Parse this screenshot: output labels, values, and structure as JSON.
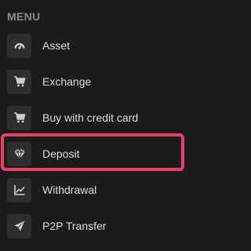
{
  "menu": {
    "heading": "MENU",
    "items": [
      {
        "label": "Asset",
        "icon": "gauge-icon"
      },
      {
        "label": "Exchange",
        "icon": "cart-icon"
      },
      {
        "label": "Buy with credit card",
        "icon": "cart-icon"
      },
      {
        "label": "Deposit",
        "icon": "diamond-icon"
      },
      {
        "label": "Withdrawal",
        "icon": "chart-icon"
      },
      {
        "label": "P2P Transfer",
        "icon": "send-icon"
      }
    ],
    "highlighted_item": "Deposit",
    "highlight_color": "#ef3b6e"
  }
}
